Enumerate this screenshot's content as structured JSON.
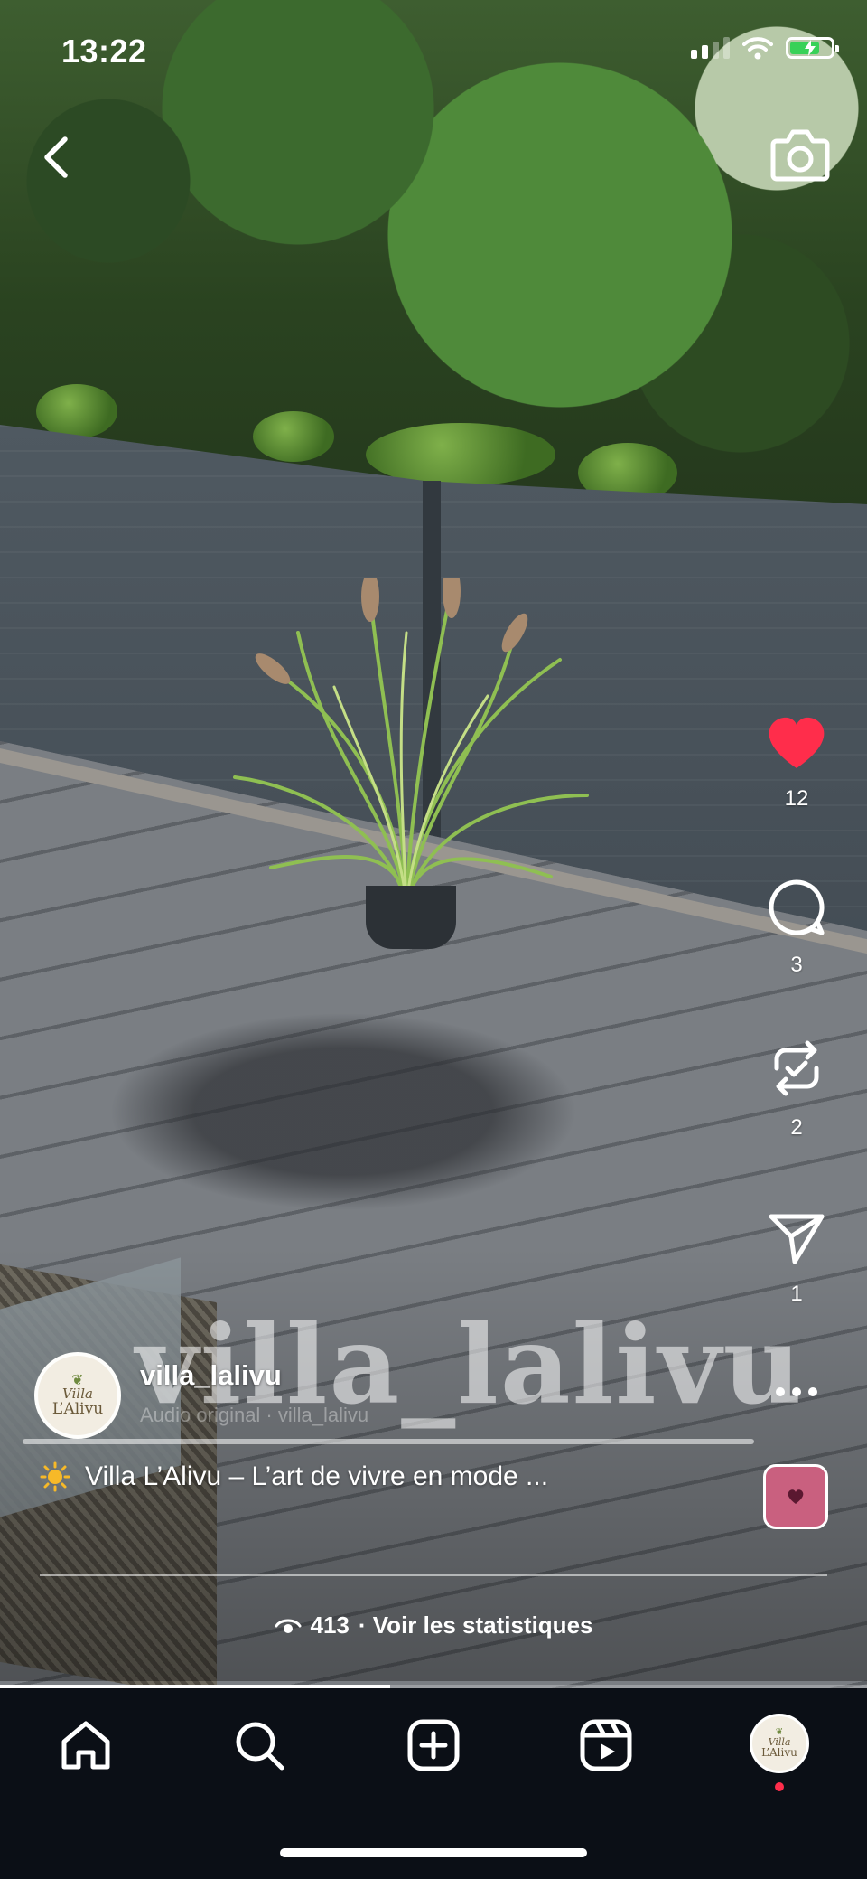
{
  "status_bar": {
    "time": "13:22",
    "signal_bars": 2,
    "battery_charging": true
  },
  "icons": {
    "back": "chevron-left-icon",
    "camera": "camera-icon",
    "like": "heart-filled-icon",
    "comment": "comment-bubble-icon",
    "repost": "repost-icon",
    "share": "paper-plane-icon",
    "more": "more-horizontal-icon",
    "views": "eye-icon"
  },
  "actions": {
    "likes": "12",
    "comments": "3",
    "reposts": "2",
    "shares": "1",
    "liked": true
  },
  "colors": {
    "like": "#ff2d4b",
    "audio_tile": "#c9607f",
    "tabbar_bg": "#0b0f16",
    "notification_dot": "#ff2d4b"
  },
  "watermark": "villa_lalivu",
  "post": {
    "username": "villa_lalivu",
    "audio": "Audio original · villa_lalivu",
    "caption_emoji": "☀️",
    "caption": "Villa L’Alivu – L’art de vivre en mode ...",
    "avatar_brand_line1": "Villa",
    "avatar_brand_line2": "L’Alivu"
  },
  "stats": {
    "views": "413",
    "label": "· Voir les statistiques"
  },
  "progress": 0.45,
  "tabs": [
    {
      "name": "home",
      "icon": "home-icon"
    },
    {
      "name": "search",
      "icon": "search-icon"
    },
    {
      "name": "create",
      "icon": "plus-square-icon"
    },
    {
      "name": "reels",
      "icon": "reels-icon"
    },
    {
      "name": "profile",
      "icon": "avatar"
    }
  ]
}
